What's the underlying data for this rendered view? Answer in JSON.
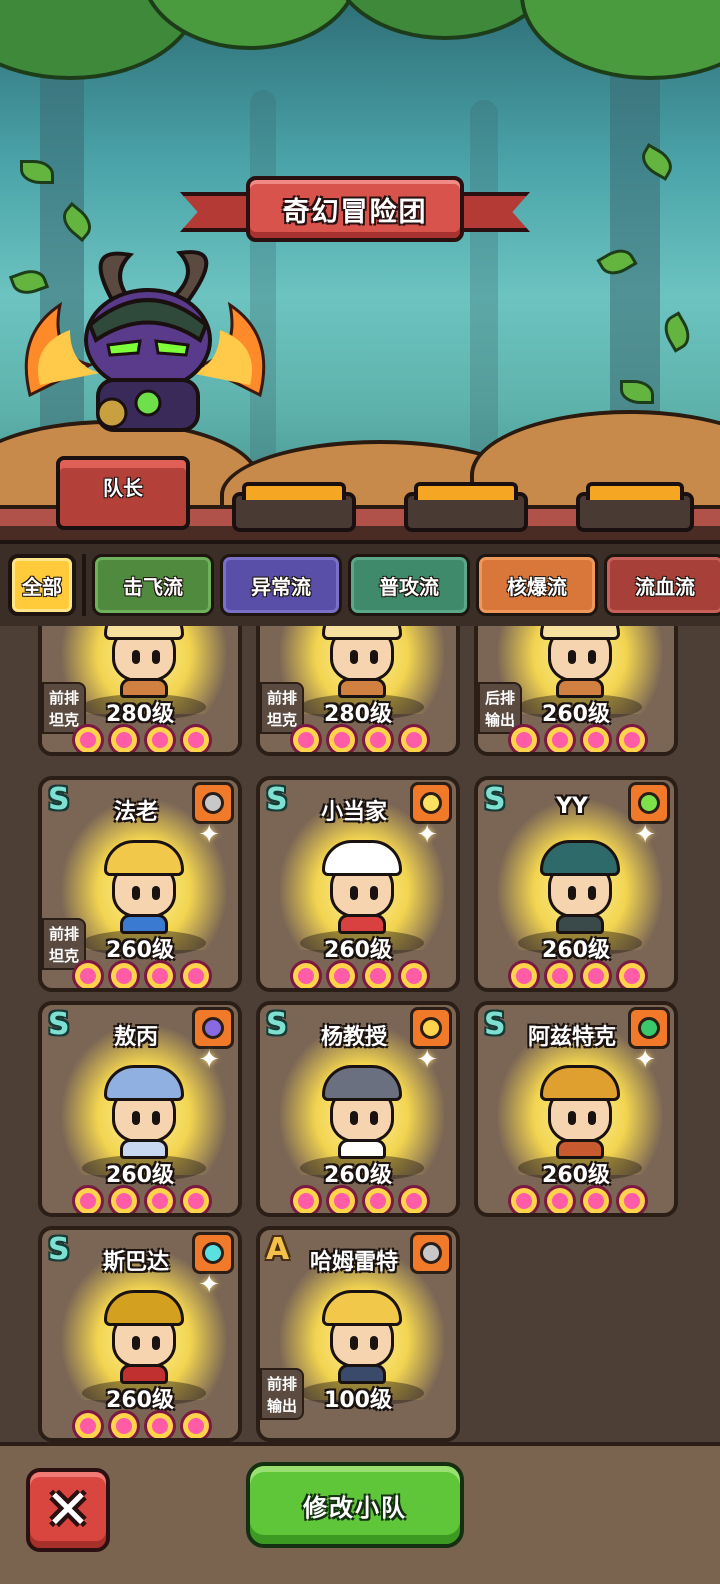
{
  "team": {
    "title": "奇幻冒险团",
    "leader_label": "队长",
    "empty_slots": 3
  },
  "filters": [
    {
      "label": "全部",
      "active": true,
      "color": "#ffcb3a"
    },
    {
      "label": "击飞流",
      "active": false,
      "color": "#4f8a3e"
    },
    {
      "label": "异常流",
      "active": false,
      "color": "#5a4fa8"
    },
    {
      "label": "普攻流",
      "active": false,
      "color": "#3f8a6a"
    },
    {
      "label": "核爆流",
      "active": false,
      "color": "#d9773a"
    },
    {
      "label": "流血流",
      "active": false,
      "color": "#a8403a"
    }
  ],
  "partial_cards": [
    {
      "level": "280级",
      "position": [
        "前排",
        "坦克"
      ]
    },
    {
      "level": "280级",
      "position": [
        "前排",
        "坦克"
      ]
    },
    {
      "level": "260级",
      "position": [
        "后排",
        "输出"
      ]
    }
  ],
  "heroes": [
    {
      "rarity": "S",
      "name": "法老",
      "level": "260级",
      "position": [
        "前排",
        "坦克"
      ],
      "icon": "ring-icon",
      "hat_color": "#f2c84a",
      "body_color": "#3a7ad0"
    },
    {
      "rarity": "S",
      "name": "小当家",
      "level": "260级",
      "position": null,
      "icon": "starburst-icon",
      "hat_color": "#ffffff",
      "body_color": "#d94040"
    },
    {
      "rarity": "S",
      "name": "YY",
      "level": "260级",
      "position": null,
      "icon": "green-orb-icon",
      "hat_color": "#2f6a6a",
      "body_color": "#3a4a4a"
    },
    {
      "rarity": "S",
      "name": "敖丙",
      "level": "260级",
      "position": null,
      "icon": "purple-ring-icon",
      "hat_color": "#8fb0e0",
      "body_color": "#c8d8f0"
    },
    {
      "rarity": "S",
      "name": "杨教授",
      "level": "260级",
      "position": null,
      "icon": "gold-ring-icon",
      "hat_color": "#6a7080",
      "body_color": "#ffffff"
    },
    {
      "rarity": "S",
      "name": "阿兹特克",
      "level": "260级",
      "position": null,
      "icon": "green-gem-icon",
      "hat_color": "#e0a030",
      "body_color": "#c85a30"
    },
    {
      "rarity": "S",
      "name": "斯巴达",
      "level": "260级",
      "position": null,
      "icon": "cyan-ring-icon",
      "hat_color": "#d4a020",
      "body_color": "#c03030"
    },
    {
      "rarity": "A",
      "name": "哈姆雷特",
      "level": "100级",
      "position": [
        "前排",
        "输出"
      ],
      "icon": "ring-icon",
      "hat_color": "#f2c84a",
      "body_color": "#3a4a6a"
    }
  ],
  "actions": {
    "close_icon": "✕",
    "modify_label": "修改小队"
  },
  "colors": {
    "accent_gold": "#ffcb3a",
    "confirm_green": "#5fc63a",
    "close_red": "#d9463f"
  }
}
